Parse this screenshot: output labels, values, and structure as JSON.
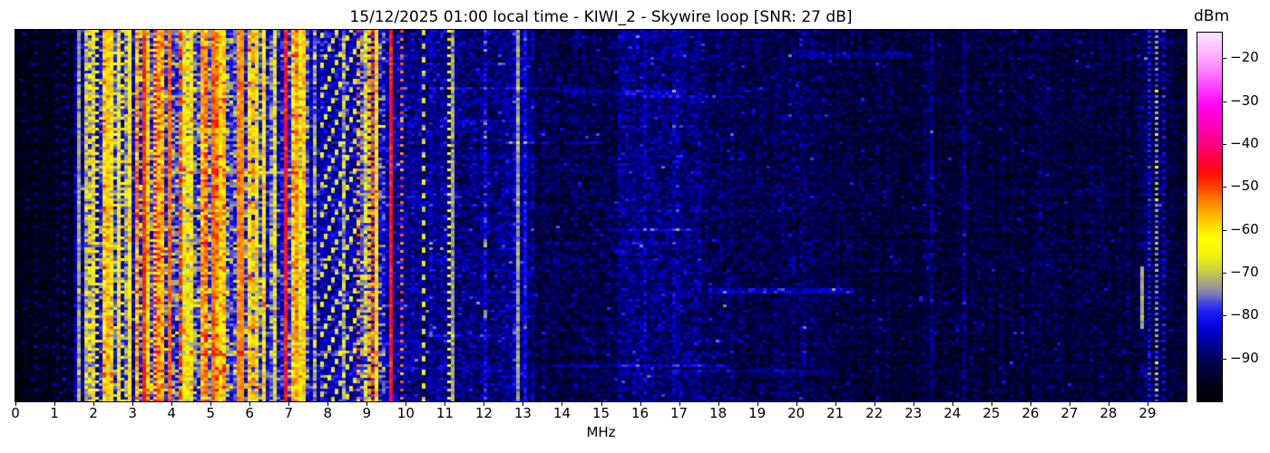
{
  "chart_data": {
    "type": "heatmap",
    "title": "15/12/2025 01:00 local time - KIWI_2 - Skywire loop [SNR: 27 dB]",
    "xlabel": "MHz",
    "xlim": [
      0,
      30
    ],
    "x_ticks": [
      0,
      1,
      2,
      3,
      4,
      5,
      6,
      7,
      8,
      9,
      10,
      11,
      12,
      13,
      14,
      15,
      16,
      17,
      18,
      19,
      20,
      21,
      22,
      23,
      24,
      25,
      26,
      27,
      28,
      29
    ],
    "colorbar": {
      "label": "dBm",
      "vmin": -100,
      "vmax": -14,
      "ticks": [
        -20,
        -30,
        -40,
        -50,
        -60,
        -70,
        -80,
        -90
      ]
    },
    "colormap": [
      [
        -100,
        "#000000"
      ],
      [
        -94,
        "#00002d"
      ],
      [
        -90,
        "#00005f"
      ],
      [
        -86,
        "#0000a4"
      ],
      [
        -82,
        "#0404e8"
      ],
      [
        -79,
        "#2020f5"
      ],
      [
        -77,
        "#4646dd"
      ],
      [
        -75,
        "#7d7db4"
      ],
      [
        -73,
        "#9e9e8d"
      ],
      [
        -71,
        "#b9b95e"
      ],
      [
        -69,
        "#d6d63a"
      ],
      [
        -66,
        "#f2f20e"
      ],
      [
        -62,
        "#ffff00"
      ],
      [
        -59,
        "#ffd900"
      ],
      [
        -56,
        "#ffab00"
      ],
      [
        -53,
        "#ff7b00"
      ],
      [
        -50,
        "#ff4000"
      ],
      [
        -47,
        "#ff1000"
      ],
      [
        -44,
        "#ff0038"
      ],
      [
        -40,
        "#ff007e"
      ],
      [
        -35,
        "#ff00c4"
      ],
      [
        -31,
        "#ff00f2"
      ],
      [
        -27,
        "#ff3cff"
      ],
      [
        -22,
        "#ff8cff"
      ],
      [
        -17,
        "#ffc6ff"
      ],
      [
        -14,
        "#ffe2ff"
      ]
    ],
    "bands": [
      [
        0.0,
        1.45,
        -96,
        2.2,
        0.02,
        4,
        8
      ],
      [
        1.45,
        1.78,
        -87,
        4,
        0.12,
        5,
        12
      ],
      [
        1.78,
        2.15,
        -84,
        5,
        0.35,
        8,
        20
      ],
      [
        2.15,
        2.62,
        -78,
        6,
        0.55,
        8,
        22
      ],
      [
        2.62,
        3.05,
        -83,
        5,
        0.32,
        7,
        20
      ],
      [
        3.05,
        5.35,
        -77,
        6,
        0.55,
        8,
        24
      ],
      [
        5.35,
        6.45,
        -78,
        6,
        0.5,
        8,
        22
      ],
      [
        6.45,
        6.95,
        -82,
        5,
        0.3,
        6,
        18
      ],
      [
        6.95,
        7.55,
        -78,
        6,
        0.5,
        8,
        22
      ],
      [
        7.55,
        7.8,
        -84,
        5,
        0.22,
        6,
        16
      ],
      [
        7.8,
        8.9,
        -85,
        5,
        0.12,
        6,
        14
      ],
      [
        8.9,
        9.5,
        -81,
        6,
        0.4,
        8,
        20
      ],
      [
        9.5,
        9.95,
        -85,
        5,
        0.15,
        5,
        12
      ],
      [
        9.95,
        10.6,
        -88,
        4,
        0.06,
        4,
        10
      ],
      [
        10.6,
        11.3,
        -87,
        4,
        0.08,
        4,
        10
      ],
      [
        11.3,
        12.4,
        -88.5,
        4,
        0.04,
        3,
        8
      ],
      [
        12.4,
        13.3,
        -89,
        4,
        0.03,
        3,
        8
      ],
      [
        13.3,
        15.4,
        -92,
        3.2,
        0.015,
        3,
        6
      ],
      [
        15.4,
        17.6,
        -88.5,
        3.5,
        0.02,
        3,
        6
      ],
      [
        17.6,
        20.5,
        -91,
        3.2,
        0.015,
        3,
        6
      ],
      [
        20.5,
        28.7,
        -93,
        2.8,
        0.008,
        3,
        6
      ],
      [
        28.7,
        29.45,
        -91,
        3.2,
        0.05,
        4,
        10
      ],
      [
        29.45,
        30.0,
        -93,
        2.8,
        0.008,
        3,
        6
      ]
    ],
    "carriers": [
      {
        "f": 0.55,
        "level": -88,
        "dash": [
          1,
          3
        ]
      },
      {
        "f": 1.05,
        "level": -87,
        "dash": [
          1,
          4
        ]
      },
      {
        "f": 1.3,
        "level": -86,
        "dash": [
          1,
          3
        ]
      },
      {
        "f": 1.62,
        "level": -73,
        "dash": null
      },
      {
        "f": 1.87,
        "level": -60,
        "dash": [
          2,
          2
        ]
      },
      {
        "f": 2.1,
        "level": -63,
        "dash": [
          1,
          2
        ]
      },
      {
        "f": 2.35,
        "level": -57,
        "dash": [
          3,
          2
        ]
      },
      {
        "f": 2.75,
        "level": -62,
        "dash": [
          1,
          3
        ]
      },
      {
        "f": 3.3,
        "level": -49,
        "dash": null
      },
      {
        "f": 3.55,
        "level": -44,
        "dash": [
          1,
          1
        ]
      },
      {
        "f": 3.95,
        "level": -52,
        "dash": null
      },
      {
        "f": 4.25,
        "level": -50,
        "dash": [
          4,
          2
        ]
      },
      {
        "f": 4.8,
        "level": -55,
        "dash": [
          2,
          2
        ]
      },
      {
        "f": 5.06,
        "level": -52,
        "dash": null
      },
      {
        "f": 5.7,
        "level": -54,
        "dash": null,
        "w": 2
      },
      {
        "f": 6.1,
        "level": -57,
        "dash": [
          5,
          2
        ]
      },
      {
        "f": 6.95,
        "level": -47,
        "dash": null
      },
      {
        "f": 7.25,
        "level": -54,
        "dash": [
          3,
          1
        ]
      },
      {
        "f": 7.42,
        "level": -58,
        "dash": [
          2,
          2
        ]
      },
      {
        "f": 8.82,
        "level": -53,
        "dash": [
          1,
          2
        ]
      },
      {
        "f": 9.05,
        "level": -57,
        "dash": [
          2,
          1
        ]
      },
      {
        "f": 9.2,
        "level": -50,
        "dash": [
          1,
          1
        ]
      },
      {
        "f": 9.62,
        "level": -47,
        "dash": null
      },
      {
        "f": 9.93,
        "level": -52,
        "dash": [
          1,
          2
        ]
      },
      {
        "f": 10.45,
        "level": -68,
        "dash": [
          2,
          3
        ]
      },
      {
        "f": 11.08,
        "level": -63,
        "dash": [
          1,
          2
        ]
      },
      {
        "f": 11.17,
        "level": -73,
        "dash": null
      },
      {
        "f": 12.85,
        "level": -73,
        "dash": null
      },
      {
        "f": 13.05,
        "level": -81,
        "dash": null
      },
      {
        "f": 16.1,
        "level": -84,
        "dash": [
          2,
          2
        ]
      },
      {
        "f": 16.85,
        "level": -84,
        "dash": [
          1,
          3
        ]
      },
      {
        "f": 29.05,
        "level": -80,
        "dash": [
          1,
          1
        ]
      },
      {
        "f": 29.2,
        "level": -74,
        "dash": [
          1,
          1
        ],
        "sparks": true
      },
      {
        "f": 29.38,
        "level": -82,
        "dash": [
          1,
          2
        ]
      }
    ],
    "chirps": [
      {
        "f0": 7.8,
        "f1": 8.85,
        "level": -67,
        "period": 11,
        "thick": 2
      }
    ],
    "segments": [
      {
        "f": 28.84,
        "y0": 0.634,
        "y1": 0.798,
        "level": -72
      }
    ],
    "streaks": [
      {
        "f0": 17.8,
        "f1": 21.5,
        "y": 0.69,
        "boost": 7
      },
      {
        "f0": 14.0,
        "f1": 17.0,
        "y": 0.16,
        "boost": 5
      },
      {
        "f0": 4.0,
        "f1": 7.5,
        "y": 0.37,
        "boost": 6
      },
      {
        "f0": 20.0,
        "f1": 23.0,
        "y": 0.055,
        "boost": 5
      },
      {
        "f0": 4.5,
        "f1": 9.5,
        "y": 0.86,
        "boost": 5
      }
    ]
  }
}
